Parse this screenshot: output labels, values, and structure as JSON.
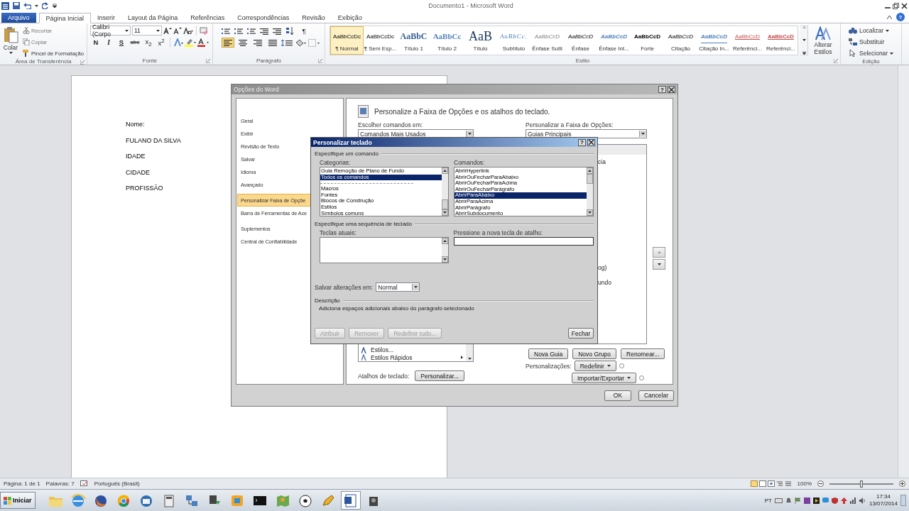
{
  "window": {
    "title": "Documento1 - Microsoft Word",
    "help": "?"
  },
  "ribbon_tabs": [
    {
      "label": "Arquivo",
      "kind": "file",
      "selected": false
    },
    {
      "label": "Página Inicial",
      "kind": "tab",
      "selected": true
    },
    {
      "label": "Inserir",
      "kind": "tab",
      "selected": false
    },
    {
      "label": "Layout da Página",
      "kind": "tab",
      "selected": false
    },
    {
      "label": "Referências",
      "kind": "tab",
      "selected": false
    },
    {
      "label": "Correspondências",
      "kind": "tab",
      "selected": false
    },
    {
      "label": "Revisão",
      "kind": "tab",
      "selected": false
    },
    {
      "label": "Exibição",
      "kind": "tab",
      "selected": false
    }
  ],
  "clipboard": {
    "label": "Área de Transferência",
    "paste": "Colar",
    "items": [
      "Recortar",
      "Copiar",
      "Pincel de Formatação"
    ]
  },
  "font": {
    "label": "Fonte",
    "name": "Calibri (Corpo",
    "size": "11",
    "format_buttons": [
      {
        "label": "N",
        "kind": "bold"
      },
      {
        "label": "I",
        "kind": "italic"
      },
      {
        "label": "S",
        "kind": "underline"
      },
      {
        "label": "abc",
        "kind": "strike"
      },
      {
        "label": "x$_{2}$",
        "kind": "sub"
      },
      {
        "label": "x$^{2}$",
        "kind": "sup"
      }
    ]
  },
  "paragraph": {
    "label": "Parágrafo",
    "marks": "¶",
    "alignments": [
      {
        "kind": "left",
        "selected": true
      },
      {
        "kind": "center",
        "selected": false
      },
      {
        "kind": "right",
        "selected": false
      },
      {
        "kind": "justify",
        "selected": false
      }
    ]
  },
  "styles": {
    "label": "Estilo",
    "change": "Alterar Estilos",
    "items": [
      {
        "sample": "AaBbCcDc",
        "name": "¶ Normal",
        "kind": "normal",
        "selected": true
      },
      {
        "sample": "AaBbCcDc",
        "name": "¶ Sem Esp...",
        "kind": "normal",
        "selected": false
      },
      {
        "sample": "AaBbC",
        "name": "Título 1",
        "kind": "heading1",
        "selected": false
      },
      {
        "sample": "AaBbCc",
        "name": "Título 2",
        "kind": "heading2",
        "selected": false
      },
      {
        "sample": "AaB",
        "name": "Título",
        "kind": "title",
        "selected": false
      },
      {
        "sample": "AaBbCc.",
        "name": "Subtítulo",
        "kind": "subtitle",
        "selected": false
      },
      {
        "sample": "AaBbCcD",
        "name": "Ênfase Sutil",
        "kind": "subtle",
        "selected": false
      },
      {
        "sample": "AaBbCcD",
        "name": "Ênfase",
        "kind": "emphasis",
        "selected": false
      },
      {
        "sample": "AaBbCcD",
        "name": "Ênfase Int...",
        "kind": "intense",
        "selected": false
      },
      {
        "sample": "AaBbCcD",
        "name": "Forte",
        "kind": "strong",
        "selected": false
      },
      {
        "sample": "AaBbCcD",
        "name": "Citação",
        "kind": "quote",
        "selected": false
      },
      {
        "sample": "AaBbCcD",
        "name": "Citação In...",
        "kind": "intense-quote",
        "selected": false
      },
      {
        "sample": "AaBbCcD",
        "name": "Referênci...",
        "kind": "reference",
        "selected": false
      },
      {
        "sample": "AaBbCcD",
        "name": "Referênci...",
        "kind": "intense-reference",
        "selected": false
      }
    ]
  },
  "editing": {
    "label": "Edição",
    "items": [
      "Localizar",
      "Substituir",
      "Selecionar"
    ]
  },
  "document": {
    "lines": [
      "Nome:",
      "FULANO DA SILVA",
      "IDADE",
      "CIDADE",
      "PROFISSÃO"
    ]
  },
  "status_bar": {
    "page": "Página: 1 de 1",
    "words": "Palavras: 7",
    "language": "Português (Brasil)",
    "zoom": "100%",
    "zoom_slider": {
      "level": 0.5
    }
  },
  "taskbar": {
    "start": "Iniciar",
    "language": "PT",
    "time": "17:34",
    "date": "13/07/2014"
  },
  "options_dialog": {
    "title": "Opções do Word",
    "help": "?",
    "nav": [
      {
        "label": "Geral",
        "selected": false
      },
      {
        "label": "Exibir",
        "selected": false
      },
      {
        "label": "Revisão de Texto",
        "selected": false
      },
      {
        "label": "Salvar",
        "selected": false
      },
      {
        "label": "Idioma",
        "selected": false
      },
      {
        "label": "Avançado",
        "selected": false
      },
      {
        "label": "Personalizar Faixa de Opçõe",
        "selected": true
      },
      {
        "label": "Barra de Ferramentas de Ace",
        "selected": false
      },
      {
        "label": "Suplementos",
        "selected": false
      },
      {
        "label": "Central de Confiabilidade",
        "selected": false
      }
    ],
    "header": "Personalize a Faixa de Opções e os atalhos do teclado.",
    "commands_label": "Escolher comandos em:",
    "commands_value": "Comandos Mais Usados",
    "commands_list": [
      "Estilos...",
      "Estilos Rápidos"
    ],
    "ribbon_label": "Personalizar a Faixa de Opções:",
    "ribbon_value": "Guias Principais",
    "tree_fragments": [
      "cia",
      "og)",
      "undo"
    ],
    "tab_buttons": [
      "Nova Guia",
      "Novo Grupo",
      "Renomear..."
    ],
    "customizations_label": "Personalizações:",
    "reset": "Redefinir",
    "import_export": "Importar/Exportar",
    "shortcuts_label": "Atalhos de teclado:",
    "customize": "Personalizar...",
    "ok": "OK",
    "cancel": "Cancelar"
  },
  "keyboard_dialog": {
    "title": "Personalizar teclado",
    "help": "?",
    "command_section": "Especifique um comando",
    "categories_label": "Categorias:",
    "categories": [
      {
        "kind": "item",
        "label": "Guia Remoção de Plano de Fundo",
        "selected": false
      },
      {
        "kind": "item",
        "label": "Todos os comandos",
        "selected": true
      },
      {
        "kind": "separator"
      },
      {
        "kind": "item",
        "label": "Macros",
        "selected": false
      },
      {
        "kind": "item",
        "label": "Fontes",
        "selected": false
      },
      {
        "kind": "item",
        "label": "Blocos de Construção",
        "selected": false
      },
      {
        "kind": "item",
        "label": "Estilos",
        "selected": false
      },
      {
        "kind": "item",
        "label": "Símbolos comuns",
        "selected": false
      }
    ],
    "commands_label": "Comandos:",
    "commands": [
      {
        "label": "AbrirHyperlink",
        "selected": false
      },
      {
        "label": "AbrirOuFecharParaAbaixo",
        "selected": false
      },
      {
        "label": "AbrirOuFecharParaAcima",
        "selected": false
      },
      {
        "label": "AbrirOuFecharParágrafo",
        "selected": false
      },
      {
        "label": "AbrirParaAbaixo",
        "selected": true
      },
      {
        "label": "AbrirParaAcima",
        "selected": false
      },
      {
        "label": "AbrirParágrafo",
        "selected": false
      },
      {
        "label": "AbrirSubdocumento",
        "selected": false
      }
    ],
    "sequence_section": "Especifique uma sequência de teclado",
    "current_keys_label": "Teclas atuais:",
    "new_key_label": "Pressione a nova tecla de atalho:",
    "save_label": "Salvar alterações em:",
    "save_value": "Normal",
    "description_label": "Descrição",
    "description": "Adiciona espaços adicionais abaixo do parágrafo selecionado",
    "buttons": [
      {
        "label": "Atribuir",
        "disabled": true
      },
      {
        "label": "Remover",
        "disabled": true
      },
      {
        "label": "Redefinir tudo...",
        "disabled": true
      }
    ],
    "close_button": "Fechar"
  }
}
